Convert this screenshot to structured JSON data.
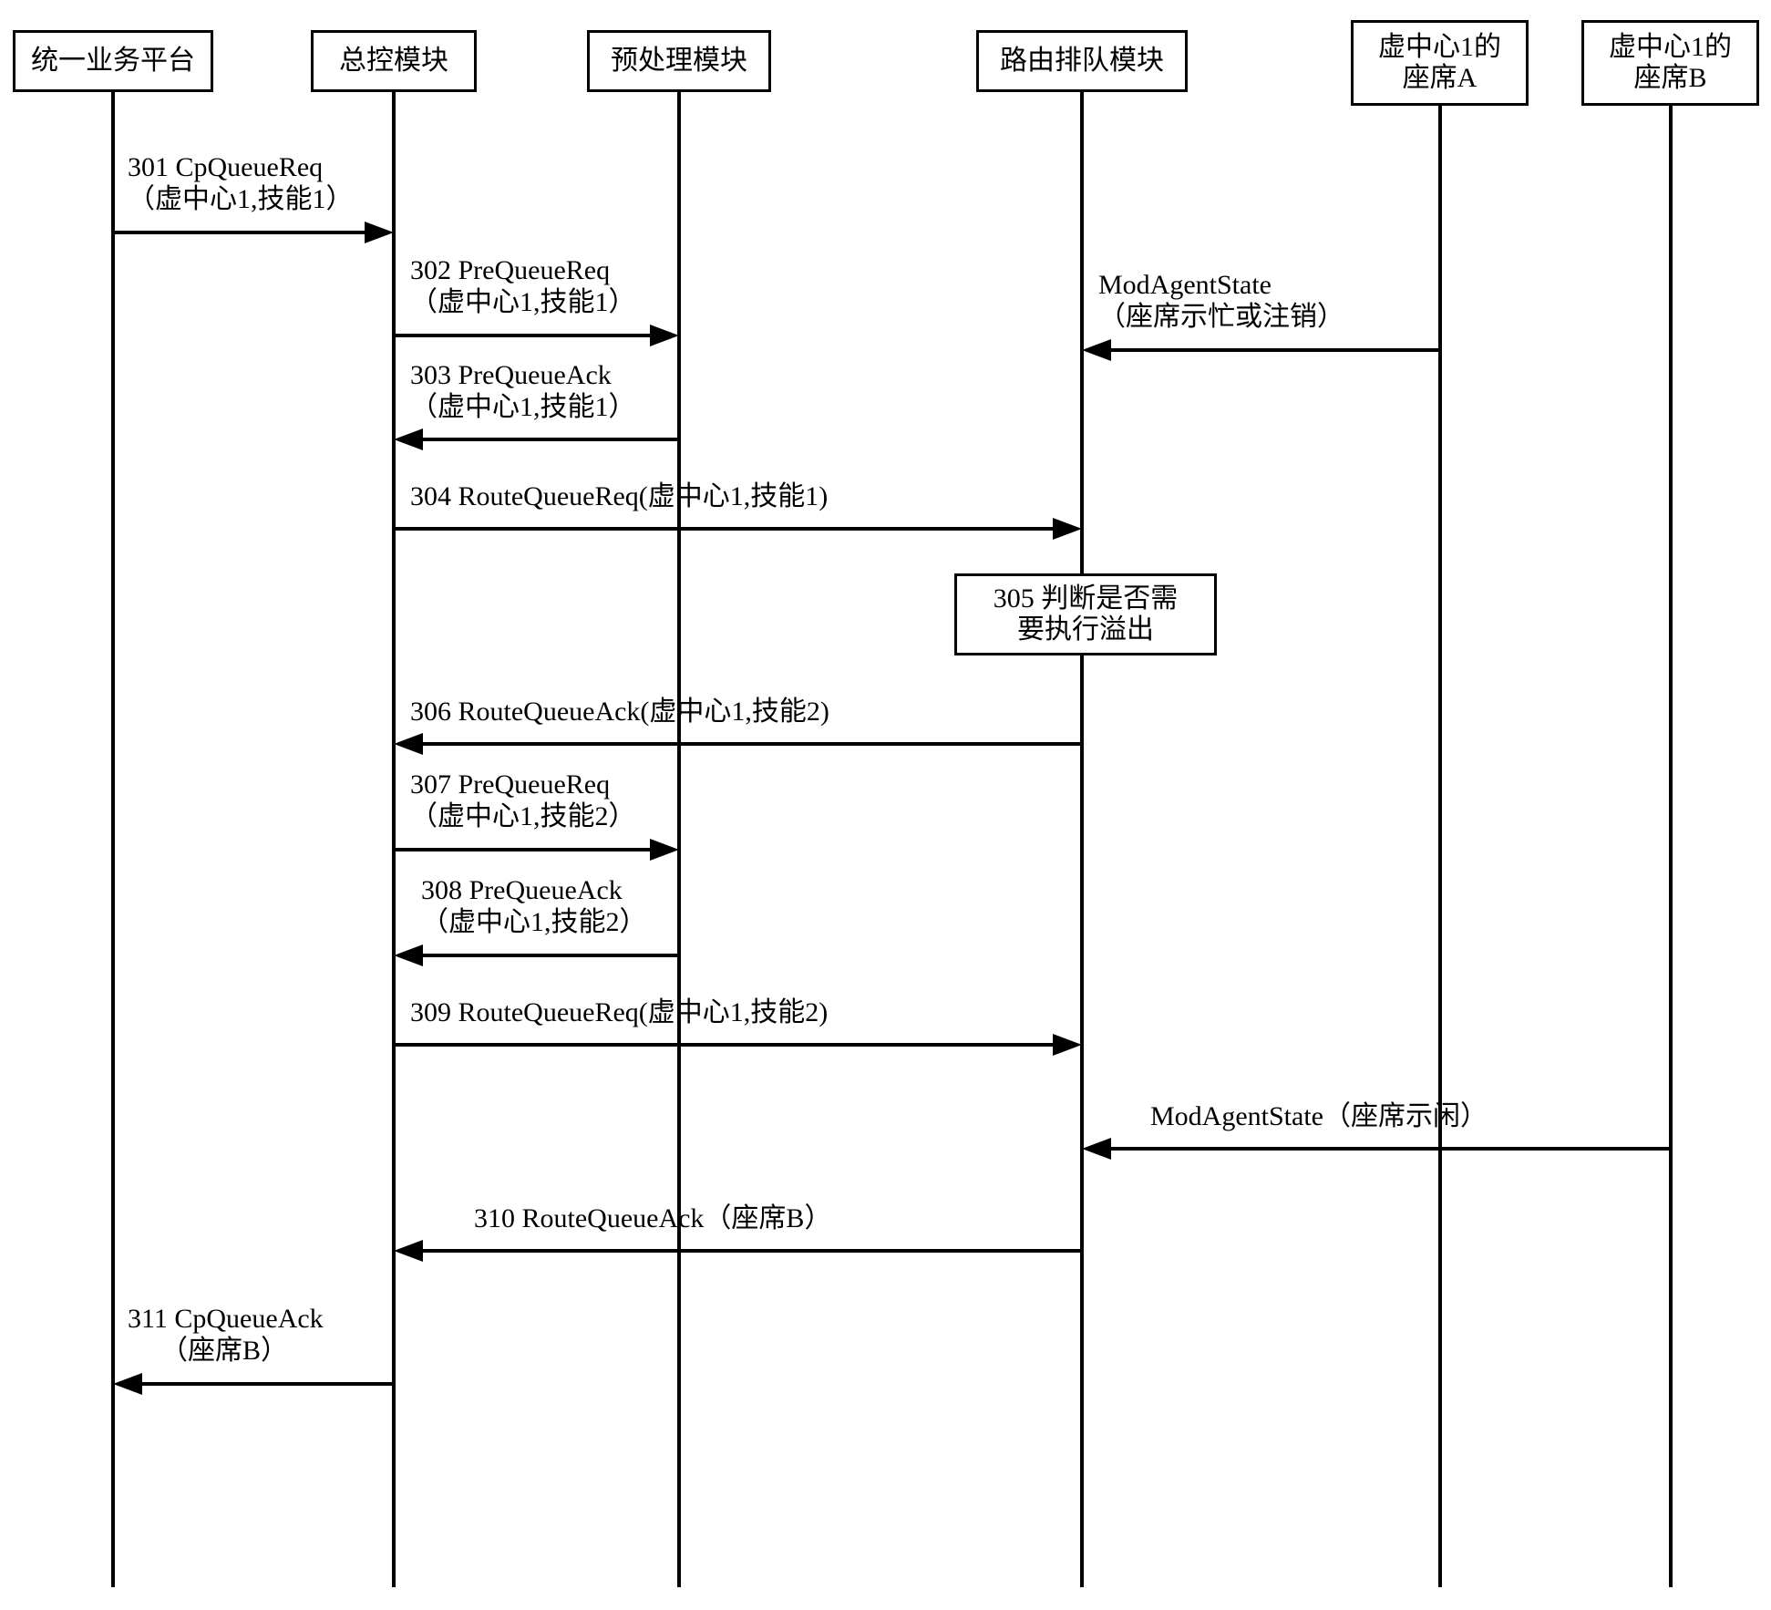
{
  "lifelines": {
    "l1": "统一业务平台",
    "l2": "总控模块",
    "l3": "预处理模块",
    "l4": "路由排队模块",
    "l5_1": "虚中心1的",
    "l5_2": "座席A",
    "l6_1": "虚中心1的",
    "l6_2": "座席B"
  },
  "messages": {
    "m301_l1": "301 CpQueueReq",
    "m301_l2": "（虚中心1,技能1）",
    "m302_l1": "302 PreQueueReq",
    "m302_l2": "（虚中心1,技能1）",
    "mMas1_l1": "ModAgentState",
    "mMas1_l2": "（座席示忙或注销）",
    "m303_l1": "303 PreQueueAck",
    "m303_l2": "（虚中心1,技能1）",
    "m304": "304 RouteQueueReq(虚中心1,技能1)",
    "m305_l1": "305 判断是否需",
    "m305_l2": "要执行溢出",
    "m306": "306 RouteQueueAck(虚中心1,技能2)",
    "m307_l1": "307 PreQueueReq",
    "m307_l2": "（虚中心1,技能2）",
    "m308_l1": "308 PreQueueAck",
    "m308_l2": "（虚中心1,技能2）",
    "m309": "309 RouteQueueReq(虚中心1,技能2)",
    "mMas2": "ModAgentState（座席示闲）",
    "m310": "310 RouteQueueAck（座席B）",
    "m311_l1": "311 CpQueueAck",
    "m311_l2": "（座席B）"
  }
}
